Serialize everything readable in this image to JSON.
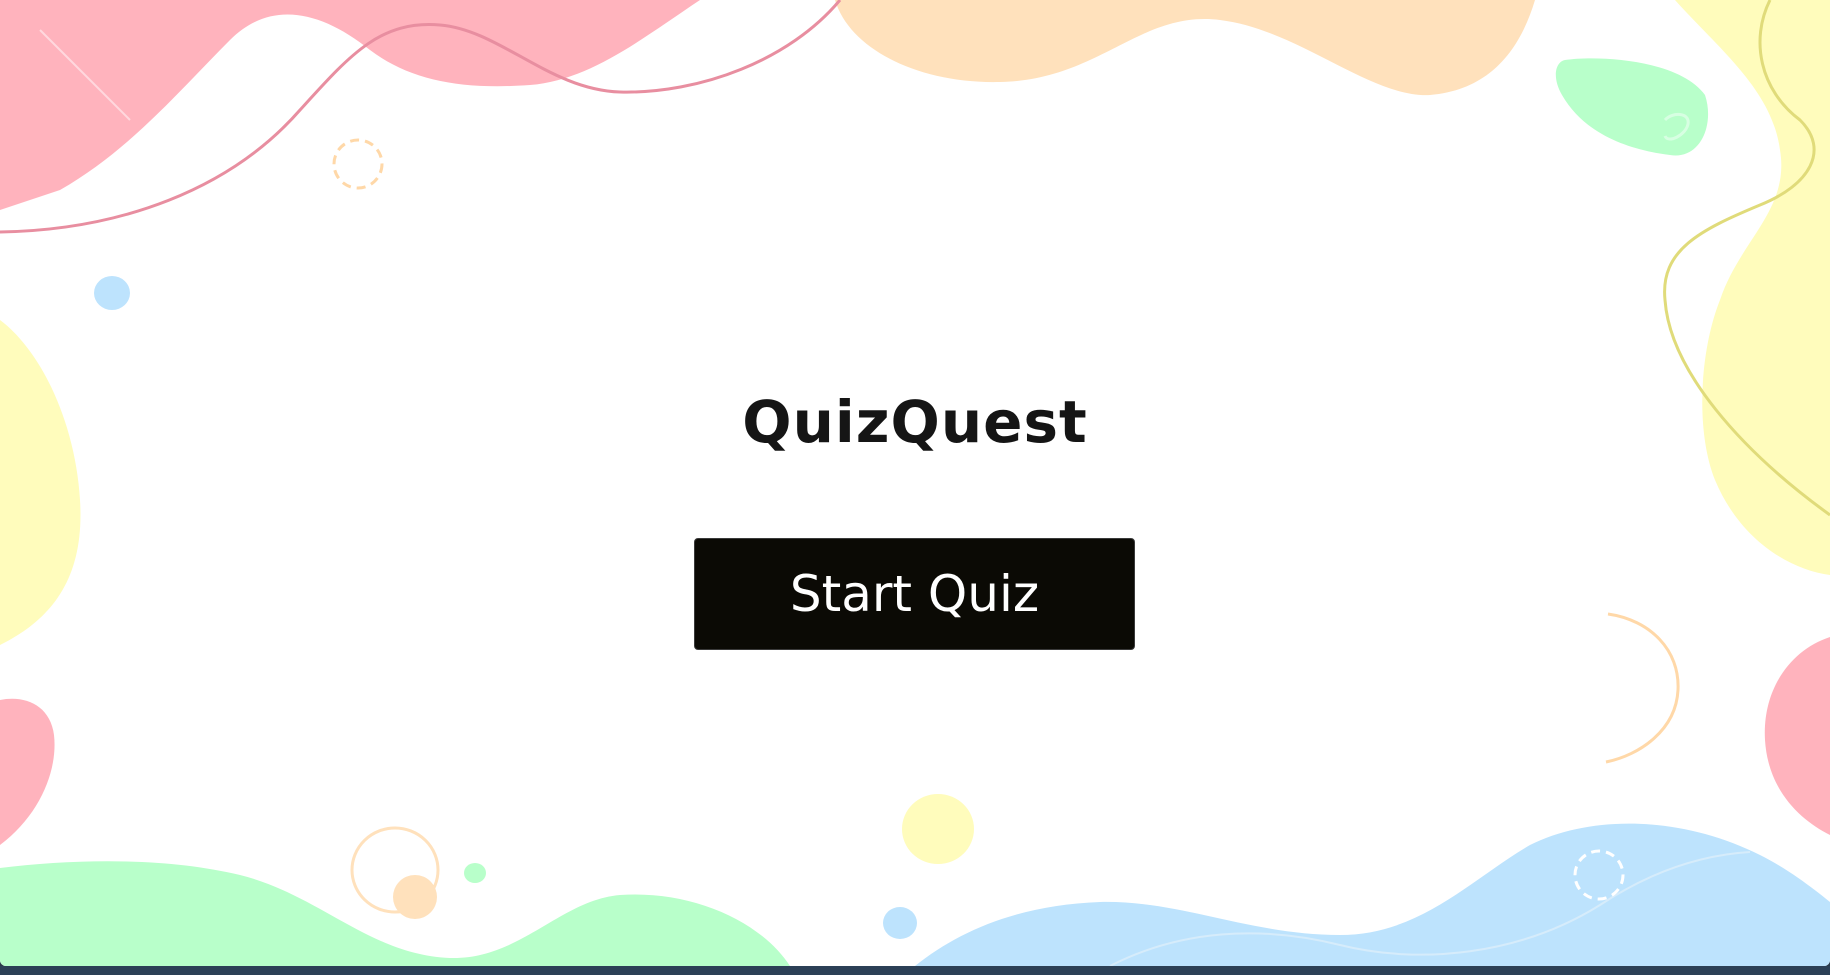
{
  "app": {
    "title": "QuizQuest",
    "start_button_label": "Start Quiz"
  },
  "colors": {
    "pink": "#ffb3bd",
    "peach": "#ffe1bc",
    "yellow": "#fffcbc",
    "mint": "#b8ffca",
    "sky": "#bde3fd",
    "button_bg": "#0b0a05",
    "button_text": "#ffffff",
    "title_text": "#151515",
    "pink_line": "#e88ea0",
    "yellow_line": "#e0db7a"
  },
  "decorations": [
    "pink-blob",
    "peach-blob",
    "yellow-blob",
    "mint-blob",
    "sky-blob",
    "wave-line",
    "dashed-circle",
    "dot"
  ]
}
